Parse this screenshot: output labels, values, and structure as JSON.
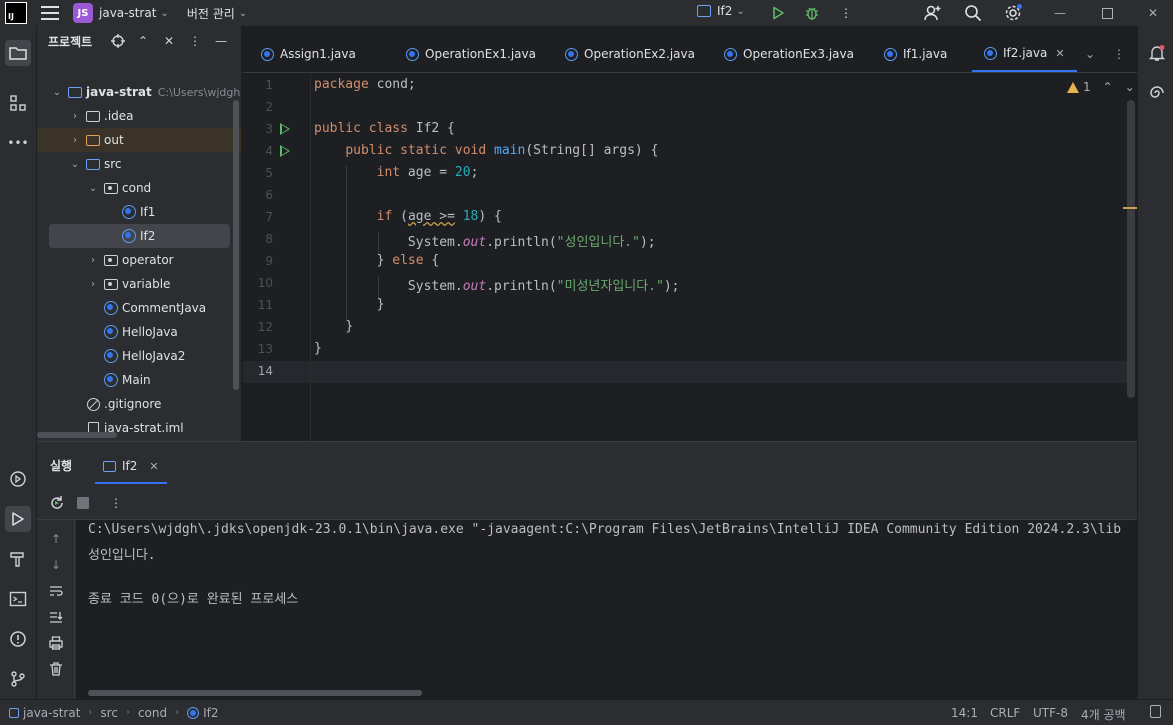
{
  "titlebar": {
    "project_badge": "JS",
    "project_name": "java-strat",
    "vcs_menu": "버전 관리",
    "run_config": "If2"
  },
  "project_panel": {
    "title": "프로젝트",
    "tree": [
      {
        "label": "java-strat",
        "hint": "C:\\Users\\wjdgh",
        "kind": "module"
      },
      {
        "label": ".idea",
        "kind": "folder"
      },
      {
        "label": "out",
        "kind": "folder-excluded"
      },
      {
        "label": "src",
        "kind": "folder-source"
      },
      {
        "label": "cond",
        "kind": "package"
      },
      {
        "label": "If1",
        "kind": "class"
      },
      {
        "label": "If2",
        "kind": "class"
      },
      {
        "label": "operator",
        "kind": "package"
      },
      {
        "label": "variable",
        "kind": "package"
      },
      {
        "label": "CommentJava",
        "kind": "class"
      },
      {
        "label": "HelloJava",
        "kind": "class"
      },
      {
        "label": "HelloJava2",
        "kind": "class"
      },
      {
        "label": "Main",
        "kind": "class"
      },
      {
        "label": ".gitignore",
        "kind": "ignore"
      },
      {
        "label": "java-strat.iml",
        "kind": "iml"
      }
    ]
  },
  "editor_tabs": [
    {
      "label": "Assign1.java"
    },
    {
      "label": "OperationEx1.java"
    },
    {
      "label": "OperationEx2.java"
    },
    {
      "label": "OperationEx3.java"
    },
    {
      "label": "If1.java"
    },
    {
      "label": "If2.java",
      "active": true
    }
  ],
  "editor": {
    "warning_count": "1",
    "line_numbers": [
      "1",
      "2",
      "3",
      "4",
      "5",
      "6",
      "7",
      "8",
      "9",
      "10",
      "11",
      "12",
      "13",
      "14"
    ],
    "code": {
      "l1_kw": "package",
      "l1_rest": " cond;",
      "l3_kw": "public class",
      "l3_rest": " If2 {",
      "l4_kw": "public static void",
      "l4_fn": "main",
      "l4_rest": "(String[] args) {",
      "l5_kw": "int",
      "l5_mid": " age = ",
      "l5_num": "20",
      "l5_end": ";",
      "l7_kw": "if",
      "l7_open": " (",
      "l7_warn": "age >=",
      "l7_sp": " ",
      "l7_num": "18",
      "l7_end": ") {",
      "l8_pre": "System.",
      "l8_fld": "out",
      "l8_mid": ".println(",
      "l8_str": "\"성인입니다.\"",
      "l8_end": ");",
      "l9_open": "} ",
      "l9_kw": "else",
      "l9_end": " {",
      "l10_pre": "System.",
      "l10_fld": "out",
      "l10_mid": ".println(",
      "l10_str": "\"미성년자입니다.\"",
      "l10_end": ");",
      "l11": "}",
      "l12": "}",
      "l13": "}"
    }
  },
  "run_window": {
    "title": "실행",
    "tab_label": "If2",
    "console_lines": [
      "C:\\Users\\wjdgh\\.jdks\\openjdk-23.0.1\\bin\\java.exe \"-javaagent:C:\\Program Files\\JetBrains\\IntelliJ IDEA Community Edition 2024.2.3\\lib",
      "성인입니다.",
      "",
      "종료 코드 0(으)로 완료된 프로세스"
    ]
  },
  "statusbar": {
    "breadcrumbs": [
      "java-strat",
      "src",
      "cond",
      "If2"
    ],
    "position": "14:1",
    "line_sep": "CRLF",
    "encoding": "UTF-8",
    "indent": "4개 공백"
  },
  "colors": {
    "accent": "#3574f0",
    "keyword": "#cf8e6d",
    "string": "#6aab73",
    "number": "#2aacb8",
    "function": "#56a8f5",
    "field": "#c77dbb",
    "run_green": "#5fb865"
  }
}
